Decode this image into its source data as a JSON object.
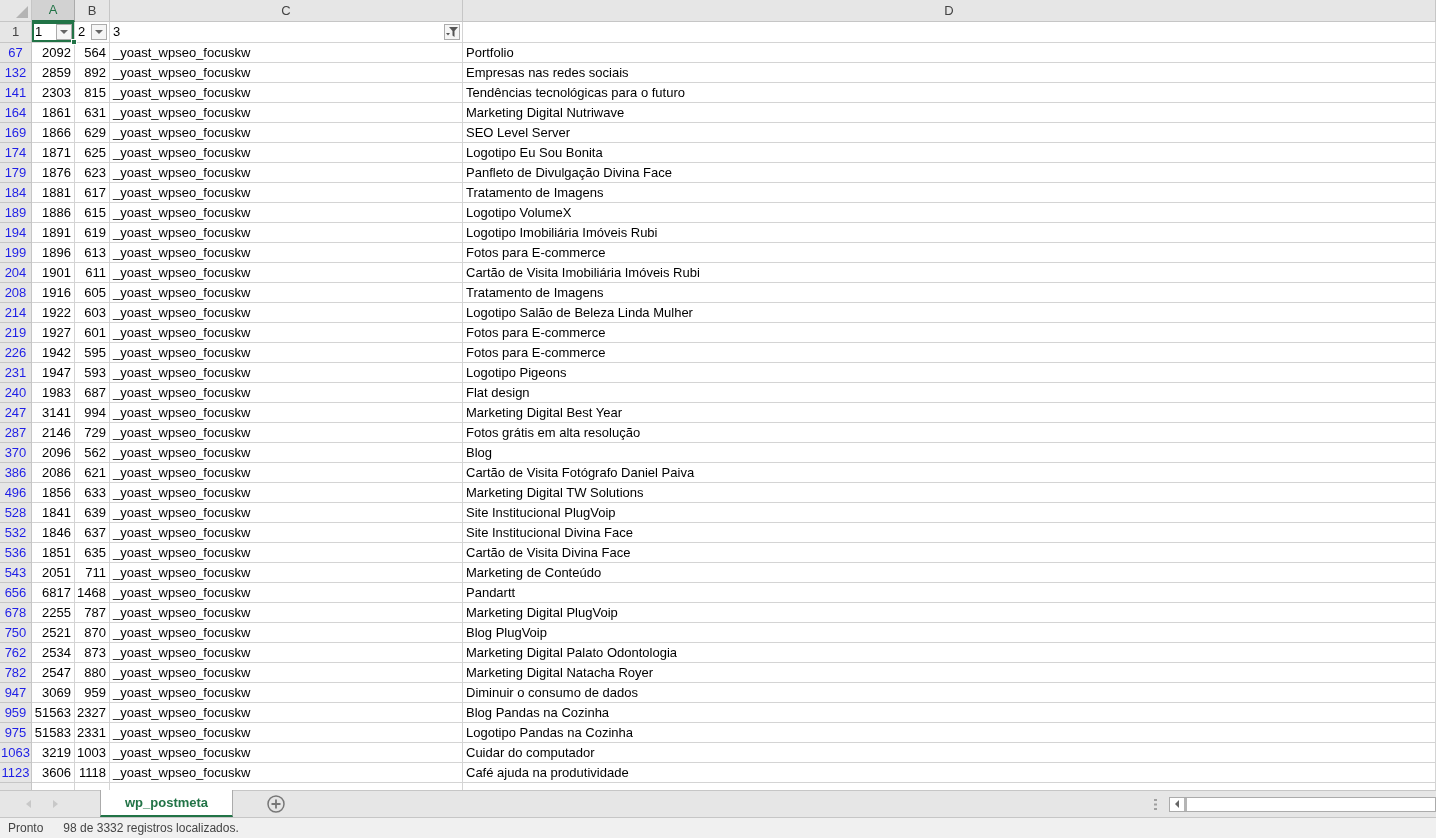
{
  "columns": [
    {
      "label": "A",
      "selected": true
    },
    {
      "label": "B",
      "selected": false
    },
    {
      "label": "C",
      "selected": false
    },
    {
      "label": "D",
      "selected": false
    }
  ],
  "header_row": {
    "number": "1",
    "cells": [
      {
        "text": "1",
        "has_filter": true,
        "filter_active": false,
        "selected": true
      },
      {
        "text": "2",
        "has_filter": true,
        "filter_active": false,
        "selected": false
      },
      {
        "text": "3",
        "has_filter": true,
        "filter_active": true,
        "selected": false
      }
    ]
  },
  "rows": [
    {
      "number": "67",
      "cells": [
        "2092",
        "564",
        "_yoast_wpseo_focuskw",
        "Portfolio"
      ]
    },
    {
      "number": "132",
      "cells": [
        "2859",
        "892",
        "_yoast_wpseo_focuskw",
        "Empresas nas redes sociais"
      ]
    },
    {
      "number": "141",
      "cells": [
        "2303",
        "815",
        "_yoast_wpseo_focuskw",
        "Tendências tecnológicas para o futuro"
      ]
    },
    {
      "number": "164",
      "cells": [
        "1861",
        "631",
        "_yoast_wpseo_focuskw",
        "Marketing Digital Nutriwave"
      ]
    },
    {
      "number": "169",
      "cells": [
        "1866",
        "629",
        "_yoast_wpseo_focuskw",
        "SEO Level Server"
      ]
    },
    {
      "number": "174",
      "cells": [
        "1871",
        "625",
        "_yoast_wpseo_focuskw",
        "Logotipo Eu Sou Bonita"
      ]
    },
    {
      "number": "179",
      "cells": [
        "1876",
        "623",
        "_yoast_wpseo_focuskw",
        "Panfleto de Divulgação Divina Face"
      ]
    },
    {
      "number": "184",
      "cells": [
        "1881",
        "617",
        "_yoast_wpseo_focuskw",
        "Tratamento de Imagens"
      ]
    },
    {
      "number": "189",
      "cells": [
        "1886",
        "615",
        "_yoast_wpseo_focuskw",
        "Logotipo VolumeX"
      ]
    },
    {
      "number": "194",
      "cells": [
        "1891",
        "619",
        "_yoast_wpseo_focuskw",
        "Logotipo Imobiliária Imóveis Rubi"
      ]
    },
    {
      "number": "199",
      "cells": [
        "1896",
        "613",
        "_yoast_wpseo_focuskw",
        "Fotos para E-commerce"
      ]
    },
    {
      "number": "204",
      "cells": [
        "1901",
        "611",
        "_yoast_wpseo_focuskw",
        "Cartão de Visita Imobiliária Imóveis Rubi"
      ]
    },
    {
      "number": "208",
      "cells": [
        "1916",
        "605",
        "_yoast_wpseo_focuskw",
        "Tratamento de Imagens"
      ]
    },
    {
      "number": "214",
      "cells": [
        "1922",
        "603",
        "_yoast_wpseo_focuskw",
        "Logotipo Salão de Beleza Linda Mulher"
      ]
    },
    {
      "number": "219",
      "cells": [
        "1927",
        "601",
        "_yoast_wpseo_focuskw",
        "Fotos para E-commerce"
      ]
    },
    {
      "number": "226",
      "cells": [
        "1942",
        "595",
        "_yoast_wpseo_focuskw",
        "Fotos para E-commerce"
      ]
    },
    {
      "number": "231",
      "cells": [
        "1947",
        "593",
        "_yoast_wpseo_focuskw",
        "Logotipo Pigeons"
      ]
    },
    {
      "number": "240",
      "cells": [
        "1983",
        "687",
        "_yoast_wpseo_focuskw",
        "Flat design"
      ]
    },
    {
      "number": "247",
      "cells": [
        "3141",
        "994",
        "_yoast_wpseo_focuskw",
        "Marketing Digital Best Year"
      ]
    },
    {
      "number": "287",
      "cells": [
        "2146",
        "729",
        "_yoast_wpseo_focuskw",
        "Fotos grátis em alta resolução"
      ]
    },
    {
      "number": "370",
      "cells": [
        "2096",
        "562",
        "_yoast_wpseo_focuskw",
        "Blog"
      ]
    },
    {
      "number": "386",
      "cells": [
        "2086",
        "621",
        "_yoast_wpseo_focuskw",
        "Cartão de Visita Fotógrafo Daniel Paiva"
      ]
    },
    {
      "number": "496",
      "cells": [
        "1856",
        "633",
        "_yoast_wpseo_focuskw",
        "Marketing Digital TW Solutions"
      ]
    },
    {
      "number": "528",
      "cells": [
        "1841",
        "639",
        "_yoast_wpseo_focuskw",
        "Site Institucional PlugVoip"
      ]
    },
    {
      "number": "532",
      "cells": [
        "1846",
        "637",
        "_yoast_wpseo_focuskw",
        "Site Institucional Divina Face"
      ]
    },
    {
      "number": "536",
      "cells": [
        "1851",
        "635",
        "_yoast_wpseo_focuskw",
        "Cartão de Visita Divina Face"
      ]
    },
    {
      "number": "543",
      "cells": [
        "2051",
        "711",
        "_yoast_wpseo_focuskw",
        "Marketing de Conteúdo"
      ]
    },
    {
      "number": "656",
      "cells": [
        "6817",
        "1468",
        "_yoast_wpseo_focuskw",
        "Pandartt"
      ]
    },
    {
      "number": "678",
      "cells": [
        "2255",
        "787",
        "_yoast_wpseo_focuskw",
        "Marketing Digital PlugVoip"
      ]
    },
    {
      "number": "750",
      "cells": [
        "2521",
        "870",
        "_yoast_wpseo_focuskw",
        "Blog PlugVoip"
      ]
    },
    {
      "number": "762",
      "cells": [
        "2534",
        "873",
        "_yoast_wpseo_focuskw",
        "Marketing Digital Palato Odontologia"
      ]
    },
    {
      "number": "782",
      "cells": [
        "2547",
        "880",
        "_yoast_wpseo_focuskw",
        "Marketing Digital Natacha Royer"
      ]
    },
    {
      "number": "947",
      "cells": [
        "3069",
        "959",
        "_yoast_wpseo_focuskw",
        "Diminuir o consumo de dados"
      ]
    },
    {
      "number": "959",
      "cells": [
        "51563",
        "2327",
        "_yoast_wpseo_focuskw",
        "Blog Pandas na Cozinha"
      ]
    },
    {
      "number": "975",
      "cells": [
        "51583",
        "2331",
        "_yoast_wpseo_focuskw",
        "Logotipo Pandas na Cozinha"
      ]
    },
    {
      "number": "1063",
      "cells": [
        "3219",
        "1003",
        "_yoast_wpseo_focuskw",
        "Cuidar do computador"
      ]
    },
    {
      "number": "1123",
      "cells": [
        "3606",
        "1118",
        "_yoast_wpseo_focuskw",
        "Café ajuda na produtividade"
      ]
    }
  ],
  "sheet_tabs": [
    {
      "label": "wp_postmeta",
      "selected": true
    }
  ],
  "status_bar": {
    "mode": "Pronto",
    "message": "98 de 3332 registros localizados."
  }
}
